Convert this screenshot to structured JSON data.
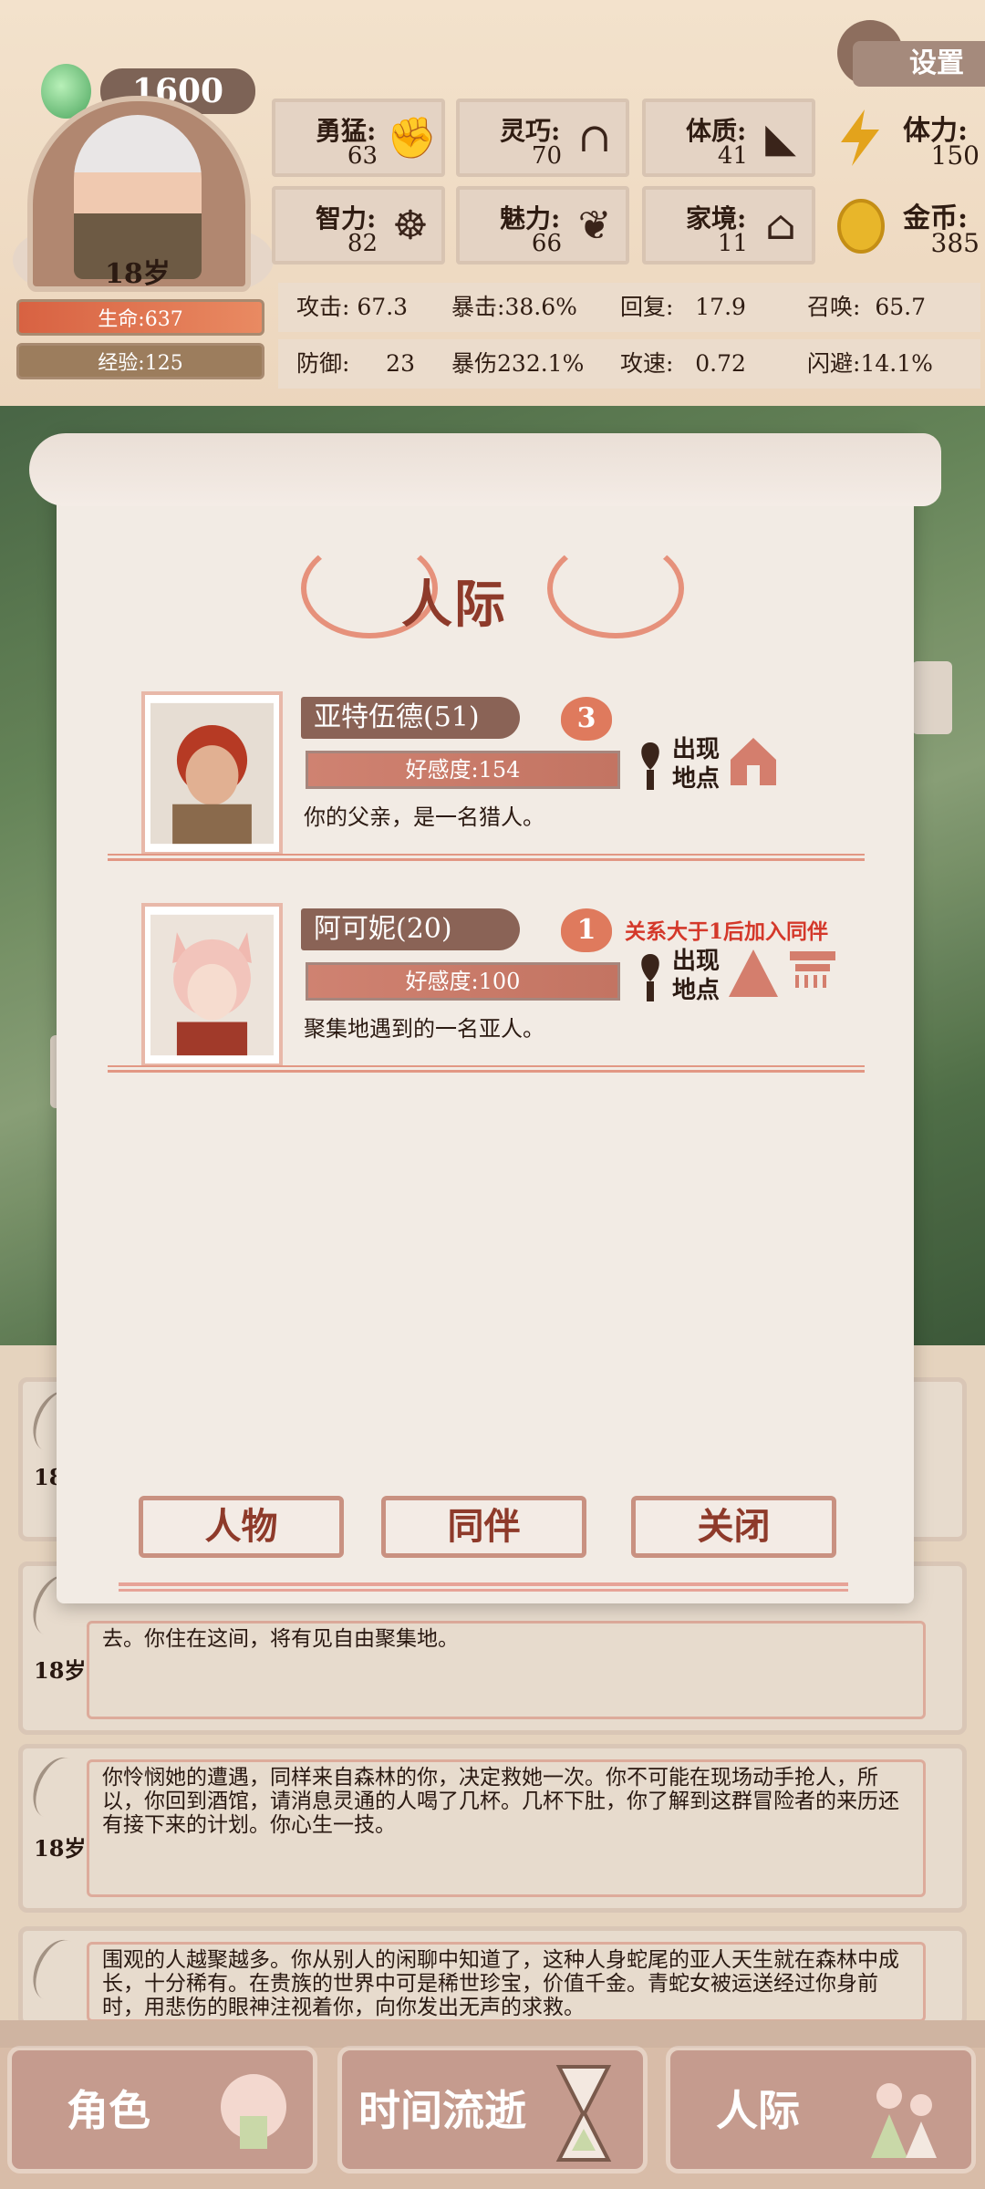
{
  "header": {
    "gems": "1600",
    "age": "18岁",
    "hp": "生命:637",
    "exp": "经验:125",
    "settings": "设置",
    "attributes": [
      {
        "label": "勇猛:",
        "value": "63",
        "icon": "fist-icon"
      },
      {
        "label": "灵巧:",
        "value": "70",
        "icon": "cloak-icon"
      },
      {
        "label": "体质:",
        "value": "41",
        "icon": "muscle-icon"
      },
      {
        "label": "智力:",
        "value": "82",
        "icon": "brain-icon"
      },
      {
        "label": "魅力:",
        "value": "66",
        "icon": "lotus-icon"
      },
      {
        "label": "家境:",
        "value": "11",
        "icon": "house-hand-icon"
      }
    ],
    "stamina": {
      "label": "体力:",
      "value": "150"
    },
    "gold": {
      "label": "金币:",
      "value": "385"
    },
    "combat": [
      {
        "label": "攻击:",
        "value": "67.3"
      },
      {
        "label": "暴击:",
        "value": "38.6%"
      },
      {
        "label": "回复:",
        "value": "17.9"
      },
      {
        "label": "召唤:",
        "value": "65.7"
      },
      {
        "label": "防御:",
        "value": "23"
      },
      {
        "label": "暴伤",
        "value": "232.1%"
      },
      {
        "label": "攻速:",
        "value": "0.72"
      },
      {
        "label": "闪避:",
        "value": "14.1%"
      }
    ]
  },
  "popup": {
    "title": "人际",
    "characters": [
      {
        "name": "亚特伍德(51)",
        "level": "3",
        "favor": "好感度:154",
        "desc": "你的父亲，是一名猎人。",
        "location_label": "出现 地点",
        "note": ""
      },
      {
        "name": "阿可妮(20)",
        "level": "1",
        "favor": "好感度:100",
        "desc": "聚集地遇到的一名亚人。",
        "location_label": "出现 地点",
        "note": "关系大于1后加入同伴"
      }
    ],
    "buttons": {
      "people": "人物",
      "companion": "同伴",
      "close": "关闭"
    }
  },
  "log": [
    {
      "age": "18岁",
      "text": ""
    },
    {
      "age": "18岁",
      "text": "去。你住在这间，将有见自由聚集地。"
    },
    {
      "age": "18岁",
      "text": "你怜悯她的遭遇，同样来自森林的你，决定救她一次。你不可能在现场动手抢人，所以，你回到酒馆，请消息灵通的人喝了几杯。几杯下肚，你了解到这群冒险者的来历还有接下来的计划。你心生一技。"
    },
    {
      "age": "18岁",
      "text": "围观的人越聚越多。你从别人的闲聊中知道了，这种人身蛇尾的亚人天生就在森林中成长，十分稀有。在贵族的世界中可是稀世珍宝，价值千金。青蛇女被运送经过你身前时，用悲伤的眼神注视着你，向你发出无声的求救。"
    }
  ],
  "nav": {
    "role": "角色",
    "time": "时间流逝",
    "social": "人际"
  },
  "colors": {
    "accent": "#8e3a2a",
    "hp": "#d86242",
    "heart": "#df7a5d"
  }
}
